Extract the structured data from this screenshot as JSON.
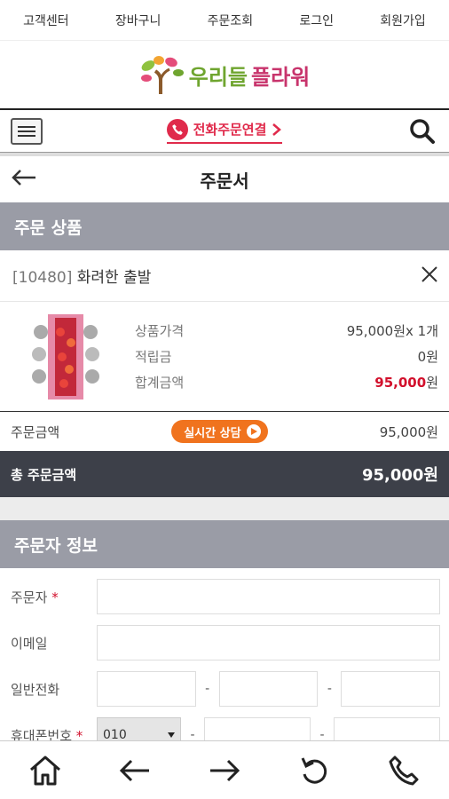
{
  "top_links": [
    "고객센터",
    "장바구니",
    "주문조회",
    "로그인",
    "회원가입"
  ],
  "logo": {
    "part1": "우리들",
    "part2": "플라워"
  },
  "navbar": {
    "phone_order": "전화주문연결"
  },
  "page": {
    "title": "주문서"
  },
  "order_section": {
    "heading": "주문 상품",
    "product": {
      "code": "[10480]",
      "name": "화려한 출발"
    },
    "details": [
      {
        "label": "상품가격",
        "value": "95,000원x 1개"
      },
      {
        "label": "적립금",
        "value": "0원"
      },
      {
        "label": "합계금액",
        "value_bold": "95,000",
        "value_unit": "원"
      }
    ],
    "order_amount_label": "주문금액",
    "consult_label": "실시간 상담",
    "order_amount": "95,000원",
    "total_label": "총 주문금액",
    "total_amount": "95,000원"
  },
  "orderer_section": {
    "heading": "주문자 정보",
    "fields": {
      "name_label": "주문자",
      "email_label": "이메일",
      "phone_label": "일반전화",
      "mobile_label": "휴대폰번호",
      "required_mark": "*",
      "mobile_prefix": "010",
      "dash": "-"
    }
  },
  "colors": {
    "accent_red": "#d2102c",
    "section_gray": "#9a9ca6",
    "total_dark": "#3d4049",
    "consult_orange": "#f0731e"
  },
  "icons": [
    "hamburger-icon",
    "phone-icon",
    "chevron-right-icon",
    "search-icon",
    "back-arrow-icon",
    "close-icon",
    "home-icon",
    "arrow-left-icon",
    "arrow-right-icon",
    "refresh-icon",
    "phone-call-icon"
  ]
}
